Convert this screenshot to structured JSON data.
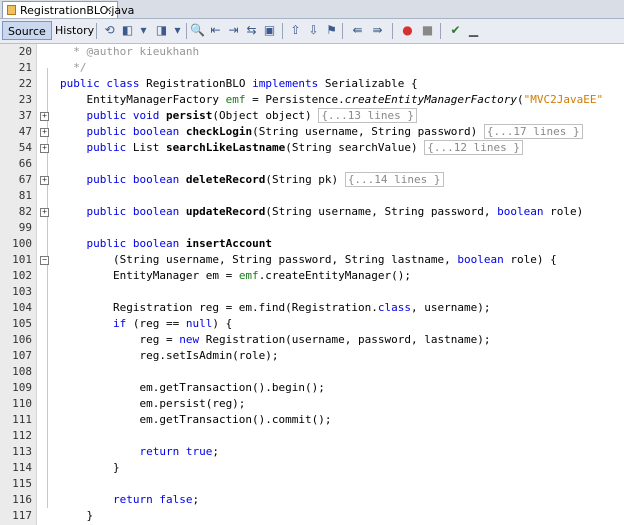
{
  "tab": {
    "label": "RegistrationBLO.java",
    "close": "×"
  },
  "toolbar": {
    "source_label": "Source",
    "history_label": "History"
  },
  "lines": [
    {
      "num": "20",
      "fold": "",
      "html": "  <span class='cm'>* @author kieukhanh</span>"
    },
    {
      "num": "21",
      "fold": "",
      "html": "  <span class='cm'>*/</span>"
    },
    {
      "num": "22",
      "fold": "",
      "html": "<span class='kw'>public class</span> RegistrationBLO <span class='kw'>implements</span> Serializable {"
    },
    {
      "num": "23",
      "fold": "",
      "html": "    EntityManagerFactory <span class='em'>emf</span> = Persistence.<span class='it'>createEntityManagerFactory</span>(<span class='st'>\"MVC2JavaEE\"</span>"
    },
    {
      "num": "37",
      "fold": "+",
      "html": "    <span class='kw'>public void</span> <span class='fn'>persist</span>(Object object) <span class='coll'>{...13 lines }</span>"
    },
    {
      "num": "47",
      "fold": "+",
      "html": "    <span class='kw'>public boolean</span> <span class='fn'>checkLogin</span>(String username, String password) <span class='coll'>{...17 lines }</span>"
    },
    {
      "num": "54",
      "fold": "+",
      "html": "    <span class='kw'>public</span> List <span class='fn'>searchLikeLastname</span>(String searchValue) <span class='coll'>{...12 lines }</span>"
    },
    {
      "num": "66",
      "fold": "",
      "html": ""
    },
    {
      "num": "67",
      "fold": "+",
      "html": "    <span class='kw'>public boolean</span> <span class='fn'>deleteRecord</span>(String pk) <span class='coll'>{...14 lines }</span>"
    },
    {
      "num": "81",
      "fold": "",
      "html": ""
    },
    {
      "num": "82",
      "fold": "+",
      "html": "    <span class='kw'>public boolean</span> <span class='fn'>updateRecord</span>(String username, String password, <span class='kw'>boolean</span> role)"
    },
    {
      "num": "99",
      "fold": "",
      "html": ""
    },
    {
      "num": "100",
      "fold": "",
      "html": "    <span class='kw'>public boolean</span> <span class='fn'>insertAccount</span>"
    },
    {
      "num": "101",
      "fold": "−",
      "html": "        (String username, String password, String lastname, <span class='kw'>boolean</span> role) {"
    },
    {
      "num": "102",
      "fold": "",
      "html": "        EntityManager em = <span class='em'>emf</span>.createEntityManager();"
    },
    {
      "num": "103",
      "fold": "",
      "html": ""
    },
    {
      "num": "104",
      "fold": "",
      "html": "        Registration reg = em.find(Registration.<span class='kw'>class</span>, username);"
    },
    {
      "num": "105",
      "fold": "",
      "html": "        <span class='kw'>if</span> (reg == <span class='kw'>null</span>) {"
    },
    {
      "num": "106",
      "fold": "",
      "html": "            reg = <span class='kw'>new</span> Registration(username, password, lastname);"
    },
    {
      "num": "107",
      "fold": "",
      "html": "            reg.setIsAdmin(role);"
    },
    {
      "num": "108",
      "fold": "",
      "html": ""
    },
    {
      "num": "109",
      "fold": "",
      "html": "            em.getTransaction().begin();"
    },
    {
      "num": "110",
      "fold": "",
      "html": "            em.persist(reg);"
    },
    {
      "num": "111",
      "fold": "",
      "html": "            em.getTransaction().commit();"
    },
    {
      "num": "112",
      "fold": "",
      "html": ""
    },
    {
      "num": "113",
      "fold": "",
      "html": "            <span class='kw'>return true</span>;"
    },
    {
      "num": "114",
      "fold": "",
      "html": "        }"
    },
    {
      "num": "115",
      "fold": "",
      "html": ""
    },
    {
      "num": "116",
      "fold": "",
      "html": "        <span class='kw'>return false</span>;"
    },
    {
      "num": "117",
      "fold": "",
      "html": "    }"
    }
  ]
}
